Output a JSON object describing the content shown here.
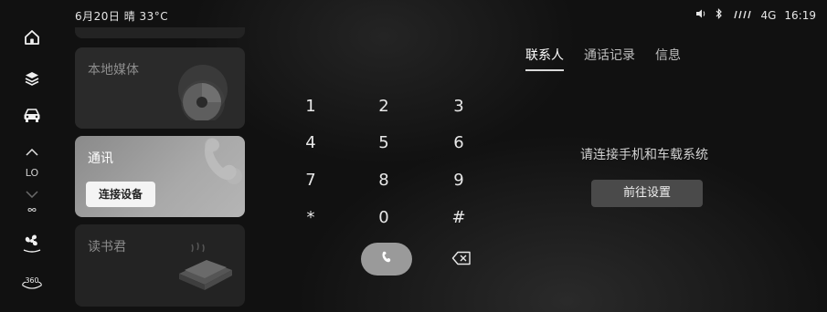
{
  "status": {
    "date_weather": "6月20日 晴 33°C",
    "network": "4G",
    "time": "16:19"
  },
  "sidebar": {
    "home_icon": "home-icon",
    "layers_icon": "layers-icon",
    "car_icon": "car-icon",
    "temp_mode": "LO",
    "fan_icon": "fan-icon",
    "view360_label": "360"
  },
  "cards": [
    {
      "title": "本地媒体",
      "icon": "vinyl-disc-icon"
    },
    {
      "title": "通讯",
      "button": "连接设备",
      "icon": "phone-handset-icon"
    },
    {
      "title": "读书君",
      "icon": "book-icon"
    }
  ],
  "dialpad": {
    "keys": [
      "1",
      "2",
      "3",
      "4",
      "5",
      "6",
      "7",
      "8",
      "9",
      "*",
      "0",
      "#"
    ]
  },
  "tabs": [
    "联系人",
    "通话记录",
    "信息"
  ],
  "message": {
    "prompt": "请连接手机和车载系统",
    "button": "前往设置"
  },
  "colors": {
    "background": "#111111",
    "active_card": "#a9a9a9",
    "call_button": "#9a9a9a"
  }
}
